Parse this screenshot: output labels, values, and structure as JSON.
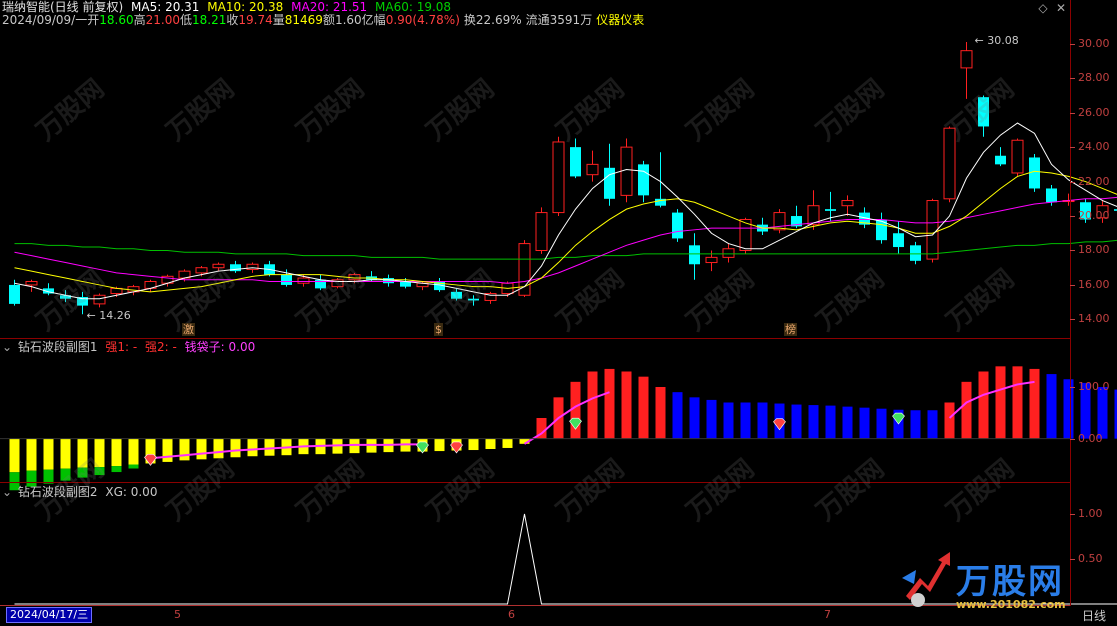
{
  "header": {
    "stock_title": "瑞纳智能(日线 前复权)",
    "ma5_label": "MA5: 20.31",
    "ma10_label": "MA10: 20.38",
    "ma20_label": "MA20: 21.51",
    "ma60_label": "MA60: 19.08"
  },
  "quote": {
    "date": "2024/09/09/一",
    "open_label": "开",
    "open": "18.60",
    "high_label": "高",
    "high": "21.00",
    "low_label": "低",
    "low": "18.21",
    "close_label": "收",
    "close": "19.74",
    "volume_label": "量",
    "volume": "81469",
    "amount_label": "额",
    "amount": "1.60亿",
    "change_label": "幅",
    "change": "0.90(4.78%)",
    "turnover": "换22.69%",
    "float": "流通3591万",
    "industry": "仪器仪表"
  },
  "indicator1": {
    "title": "钻石波段副图1",
    "strong1": "强1: -",
    "strong2": "强2: -",
    "wallet": "钱袋子: 0.00"
  },
  "indicator2": {
    "title": "钻石波段副图2",
    "xg": "XG: 0.00"
  },
  "price_axis": [
    "30.00",
    "28.00",
    "26.00",
    "24.00",
    "22.00",
    "20.00",
    "18.00",
    "16.00",
    "14.00"
  ],
  "ind1_axis": [
    "100.0",
    "0.00"
  ],
  "ind2_axis": [
    "1.00",
    "0.50"
  ],
  "annotations": {
    "high_marker": "30.08",
    "low_marker": "14.26"
  },
  "event_tags": [
    "激",
    "$",
    "榜"
  ],
  "bottom": {
    "cursor_date": "2024/04/17/三",
    "months": [
      "5",
      "6",
      "7"
    ],
    "period": "日线"
  },
  "logo": {
    "text": "万股网",
    "url": "www.201082.com"
  },
  "watermark": "万股网",
  "colors": {
    "up": "#ff2020",
    "down": "#00ffff",
    "ma5": "#ffffff",
    "ma10": "#ffff00",
    "ma20": "#ff00ff",
    "ma60": "#00c000",
    "volume_blue": "#0000ff",
    "yellow": "#ffff00"
  },
  "chart_data": {
    "type": "candlestick",
    "candles": [
      {
        "o": 16.0,
        "h": 16.3,
        "l": 14.8,
        "c": 14.9
      },
      {
        "o": 16.0,
        "h": 16.3,
        "l": 15.6,
        "c": 16.2
      },
      {
        "o": 15.8,
        "h": 16.1,
        "l": 15.4,
        "c": 15.5
      },
      {
        "o": 15.4,
        "h": 15.7,
        "l": 15.0,
        "c": 15.2
      },
      {
        "o": 15.3,
        "h": 15.6,
        "l": 14.3,
        "c": 14.8
      },
      {
        "o": 14.9,
        "h": 15.5,
        "l": 14.7,
        "c": 15.4
      },
      {
        "o": 15.5,
        "h": 15.9,
        "l": 15.3,
        "c": 15.8
      },
      {
        "o": 15.6,
        "h": 16.0,
        "l": 15.4,
        "c": 15.9
      },
      {
        "o": 15.8,
        "h": 16.3,
        "l": 15.6,
        "c": 16.2
      },
      {
        "o": 16.1,
        "h": 16.6,
        "l": 15.9,
        "c": 16.5
      },
      {
        "o": 16.4,
        "h": 16.9,
        "l": 16.2,
        "c": 16.8
      },
      {
        "o": 16.7,
        "h": 17.1,
        "l": 16.5,
        "c": 17.0
      },
      {
        "o": 17.0,
        "h": 17.3,
        "l": 16.8,
        "c": 17.2
      },
      {
        "o": 17.2,
        "h": 17.4,
        "l": 16.7,
        "c": 16.8
      },
      {
        "o": 16.9,
        "h": 17.3,
        "l": 16.7,
        "c": 17.2
      },
      {
        "o": 17.2,
        "h": 17.4,
        "l": 16.5,
        "c": 16.6
      },
      {
        "o": 16.6,
        "h": 16.9,
        "l": 15.9,
        "c": 16.0
      },
      {
        "o": 16.1,
        "h": 16.6,
        "l": 15.9,
        "c": 16.4
      },
      {
        "o": 16.3,
        "h": 16.6,
        "l": 15.7,
        "c": 15.8
      },
      {
        "o": 15.9,
        "h": 16.4,
        "l": 15.8,
        "c": 16.3
      },
      {
        "o": 16.3,
        "h": 16.7,
        "l": 16.1,
        "c": 16.6
      },
      {
        "o": 16.5,
        "h": 16.8,
        "l": 16.2,
        "c": 16.3
      },
      {
        "o": 16.4,
        "h": 16.6,
        "l": 15.9,
        "c": 16.1
      },
      {
        "o": 16.2,
        "h": 16.4,
        "l": 15.8,
        "c": 15.9
      },
      {
        "o": 15.9,
        "h": 16.2,
        "l": 15.7,
        "c": 16.1
      },
      {
        "o": 16.2,
        "h": 16.4,
        "l": 15.6,
        "c": 15.7
      },
      {
        "o": 15.6,
        "h": 15.8,
        "l": 15.1,
        "c": 15.2
      },
      {
        "o": 15.2,
        "h": 15.4,
        "l": 14.8,
        "c": 15.1
      },
      {
        "o": 15.1,
        "h": 15.6,
        "l": 14.9,
        "c": 15.5
      },
      {
        "o": 15.5,
        "h": 16.2,
        "l": 15.3,
        "c": 16.1
      },
      {
        "o": 15.4,
        "h": 18.6,
        "l": 15.3,
        "c": 18.4
      },
      {
        "o": 18.0,
        "h": 20.5,
        "l": 17.8,
        "c": 20.2
      },
      {
        "o": 20.2,
        "h": 24.6,
        "l": 20.0,
        "c": 24.3
      },
      {
        "o": 24.0,
        "h": 24.5,
        "l": 22.2,
        "c": 22.3
      },
      {
        "o": 22.4,
        "h": 23.8,
        "l": 22.0,
        "c": 23.0
      },
      {
        "o": 22.8,
        "h": 24.2,
        "l": 20.6,
        "c": 21.0
      },
      {
        "o": 21.2,
        "h": 24.5,
        "l": 20.8,
        "c": 24.0
      },
      {
        "o": 23.0,
        "h": 23.2,
        "l": 20.8,
        "c": 21.2
      },
      {
        "o": 21.0,
        "h": 23.7,
        "l": 20.5,
        "c": 20.6
      },
      {
        "o": 20.2,
        "h": 20.4,
        "l": 18.5,
        "c": 18.7
      },
      {
        "o": 18.3,
        "h": 19.0,
        "l": 16.3,
        "c": 17.2
      },
      {
        "o": 17.3,
        "h": 18.0,
        "l": 16.8,
        "c": 17.6
      },
      {
        "o": 17.6,
        "h": 18.4,
        "l": 17.3,
        "c": 18.1
      },
      {
        "o": 18.0,
        "h": 19.9,
        "l": 17.8,
        "c": 19.8
      },
      {
        "o": 19.5,
        "h": 19.9,
        "l": 18.9,
        "c": 19.1
      },
      {
        "o": 19.2,
        "h": 20.4,
        "l": 19.0,
        "c": 20.2
      },
      {
        "o": 20.0,
        "h": 20.6,
        "l": 19.3,
        "c": 19.4
      },
      {
        "o": 19.5,
        "h": 21.5,
        "l": 19.2,
        "c": 20.6
      },
      {
        "o": 20.4,
        "h": 21.4,
        "l": 19.7,
        "c": 20.3
      },
      {
        "o": 20.6,
        "h": 21.2,
        "l": 20.0,
        "c": 20.9
      },
      {
        "o": 20.2,
        "h": 20.5,
        "l": 19.3,
        "c": 19.5
      },
      {
        "o": 19.8,
        "h": 20.2,
        "l": 18.4,
        "c": 18.6
      },
      {
        "o": 19.0,
        "h": 19.7,
        "l": 17.8,
        "c": 18.2
      },
      {
        "o": 18.3,
        "h": 18.5,
        "l": 17.2,
        "c": 17.4
      },
      {
        "o": 17.5,
        "h": 21.0,
        "l": 17.3,
        "c": 20.9
      },
      {
        "o": 21.0,
        "h": 25.2,
        "l": 20.8,
        "c": 25.1
      },
      {
        "o": 28.6,
        "h": 30.1,
        "l": 26.8,
        "c": 29.6
      },
      {
        "o": 26.9,
        "h": 27.0,
        "l": 24.6,
        "c": 25.2
      },
      {
        "o": 23.5,
        "h": 24.0,
        "l": 22.9,
        "c": 23.0
      },
      {
        "o": 22.5,
        "h": 24.5,
        "l": 22.3,
        "c": 24.4
      },
      {
        "o": 23.4,
        "h": 23.6,
        "l": 21.4,
        "c": 21.6
      },
      {
        "o": 21.6,
        "h": 21.8,
        "l": 20.6,
        "c": 20.8
      },
      {
        "o": 20.9,
        "h": 21.3,
        "l": 20.6,
        "c": 20.9
      },
      {
        "o": 20.8,
        "h": 21.0,
        "l": 19.6,
        "c": 19.8
      },
      {
        "o": 19.9,
        "h": 20.9,
        "l": 19.6,
        "c": 20.6
      },
      {
        "o": 20.4,
        "h": 20.8,
        "l": 20.0,
        "c": 20.3
      },
      {
        "o": 20.6,
        "h": 20.9,
        "l": 20.4,
        "c": 20.8
      },
      {
        "o": 20.9,
        "h": 21.2,
        "l": 20.2,
        "c": 20.3
      },
      {
        "o": 20.2,
        "h": 20.5,
        "l": 19.8,
        "c": 19.9
      },
      {
        "o": 19.9,
        "h": 20.3,
        "l": 19.6,
        "c": 20.1
      },
      {
        "o": 20.2,
        "h": 20.7,
        "l": 20.0,
        "c": 20.5
      },
      {
        "o": 20.2,
        "h": 20.5,
        "l": 19.8,
        "c": 20.0
      },
      {
        "o": 18.6,
        "h": 22.3,
        "l": 18.2,
        "c": 19.7
      },
      {
        "o": 20.5,
        "h": 22.2,
        "l": 20.0,
        "c": 21.2
      }
    ],
    "ma5": [
      16.1,
      15.9,
      15.6,
      15.4,
      15.2,
      15.2,
      15.4,
      15.6,
      15.8,
      16.1,
      16.4,
      16.6,
      16.8,
      16.9,
      17.0,
      16.9,
      16.7,
      16.5,
      16.3,
      16.2,
      16.2,
      16.3,
      16.3,
      16.2,
      16.1,
      16.0,
      15.8,
      15.6,
      15.4,
      15.4,
      15.9,
      17.1,
      18.9,
      20.4,
      21.6,
      22.4,
      22.7,
      22.6,
      22.0,
      21.1,
      20.1,
      19.0,
      18.4,
      18.1,
      18.1,
      18.6,
      19.1,
      19.6,
      19.9,
      20.1,
      19.9,
      19.7,
      19.3,
      18.8,
      18.9,
      20.0,
      22.2,
      23.7,
      24.7,
      25.4,
      24.8,
      23.0,
      22.1,
      21.5,
      20.9,
      20.5,
      20.4,
      20.5,
      20.4,
      20.3,
      20.3,
      20.2,
      20.3,
      20.3
    ],
    "ma10": [
      17.0,
      16.8,
      16.6,
      16.4,
      16.2,
      16.0,
      15.8,
      15.7,
      15.6,
      15.7,
      15.8,
      15.9,
      16.1,
      16.3,
      16.5,
      16.6,
      16.6,
      16.6,
      16.6,
      16.5,
      16.4,
      16.4,
      16.3,
      16.3,
      16.2,
      16.1,
      16.0,
      15.9,
      15.9,
      15.8,
      15.9,
      16.4,
      17.3,
      18.3,
      19.1,
      19.8,
      20.4,
      20.7,
      20.9,
      21.0,
      20.8,
      20.4,
      20.0,
      19.6,
      19.3,
      19.3,
      19.2,
      19.4,
      19.6,
      19.7,
      19.6,
      19.5,
      19.3,
      19.0,
      19.0,
      19.4,
      20.0,
      20.8,
      21.6,
      22.3,
      22.6,
      22.5,
      22.3,
      22.0,
      21.6,
      21.2,
      20.8,
      20.5,
      20.4,
      20.4,
      20.3,
      20.3,
      20.3,
      20.3
    ],
    "ma20": [
      17.9,
      17.7,
      17.5,
      17.3,
      17.1,
      16.9,
      16.7,
      16.6,
      16.5,
      16.4,
      16.3,
      16.3,
      16.3,
      16.3,
      16.3,
      16.2,
      16.2,
      16.2,
      16.2,
      16.2,
      16.2,
      16.2,
      16.2,
      16.2,
      16.2,
      16.2,
      16.2,
      16.2,
      16.2,
      16.1,
      16.2,
      16.4,
      16.7,
      17.1,
      17.5,
      17.9,
      18.3,
      18.6,
      18.9,
      19.1,
      19.2,
      19.3,
      19.3,
      19.3,
      19.3,
      19.4,
      19.5,
      19.6,
      19.7,
      19.8,
      19.8,
      19.8,
      19.7,
      19.6,
      19.6,
      19.7,
      19.9,
      20.1,
      20.3,
      20.5,
      20.7,
      20.8,
      20.9,
      21.0,
      21.0,
      21.1,
      21.2,
      21.2,
      21.3,
      21.3,
      21.4,
      21.4,
      21.5,
      21.5
    ],
    "ma60": [
      18.4,
      18.4,
      18.3,
      18.3,
      18.2,
      18.2,
      18.1,
      18.1,
      18.0,
      18.0,
      17.9,
      17.9,
      17.9,
      17.8,
      17.8,
      17.8,
      17.8,
      17.7,
      17.7,
      17.7,
      17.7,
      17.6,
      17.6,
      17.6,
      17.6,
      17.5,
      17.5,
      17.5,
      17.5,
      17.5,
      17.5,
      17.5,
      17.6,
      17.6,
      17.7,
      17.7,
      17.7,
      17.8,
      17.8,
      17.8,
      17.8,
      17.8,
      17.8,
      17.8,
      17.8,
      17.8,
      17.8,
      17.8,
      17.8,
      17.8,
      17.8,
      17.8,
      17.8,
      17.8,
      17.8,
      17.9,
      18.0,
      18.1,
      18.2,
      18.3,
      18.3,
      18.4,
      18.4,
      18.5,
      18.5,
      18.6,
      18.6,
      18.7,
      18.7,
      18.8,
      18.8,
      18.9,
      19.0,
      19.1
    ],
    "ind1_bars": [
      -65,
      -62,
      -60,
      -58,
      -56,
      -55,
      -53,
      -50,
      -48,
      -45,
      -42,
      -40,
      -38,
      -36,
      -34,
      -33,
      -32,
      -30,
      -30,
      -29,
      -28,
      -27,
      -26,
      -25,
      -25,
      -24,
      -23,
      -22,
      -20,
      -18,
      -10,
      40,
      80,
      110,
      130,
      135,
      130,
      120,
      100,
      90,
      80,
      75,
      70,
      70,
      70,
      68,
      66,
      65,
      64,
      62,
      60,
      58,
      56,
      55,
      55,
      70,
      110,
      130,
      140,
      140,
      135,
      125,
      115,
      108,
      100,
      95,
      90,
      85,
      80,
      74,
      68,
      60,
      50,
      38
    ],
    "ind1_line": [
      null,
      null,
      null,
      null,
      null,
      null,
      null,
      null,
      -38,
      -35,
      -32,
      -29,
      -26,
      -23,
      -21,
      -19,
      -17,
      -15,
      -14,
      -13,
      -12,
      -12,
      -12,
      -11,
      -11,
      null,
      null,
      null,
      null,
      null,
      -10,
      10,
      40,
      62,
      78,
      90,
      null,
      null,
      null,
      null,
      null,
      null,
      null,
      null,
      null,
      null,
      null,
      null,
      null,
      null,
      null,
      null,
      null,
      null,
      null,
      40,
      70,
      85,
      95,
      105,
      110,
      null,
      null,
      null,
      null,
      null,
      null,
      null,
      null,
      null,
      null,
      null,
      null,
      null
    ],
    "ind2_values": [
      0,
      0,
      0,
      0,
      0,
      0,
      0,
      0,
      0,
      0,
      0,
      0,
      0,
      0,
      0,
      0,
      0,
      0,
      0,
      0,
      0,
      0,
      0,
      0,
      0,
      0,
      0,
      0,
      0,
      0,
      1,
      0,
      0,
      0,
      0,
      0,
      0,
      0,
      0,
      0,
      0,
      0,
      0,
      0,
      0,
      0,
      0,
      0,
      0,
      0,
      0,
      0,
      0,
      0,
      0,
      0,
      0,
      0,
      0,
      0,
      0,
      0,
      0,
      0,
      0,
      0,
      0,
      0,
      0,
      0,
      0,
      0,
      0,
      0
    ],
    "price_ylim": [
      13.5,
      30.8
    ],
    "ind1_ylim": [
      -80,
      160
    ],
    "ind2_ylim": [
      0,
      1.2
    ]
  }
}
